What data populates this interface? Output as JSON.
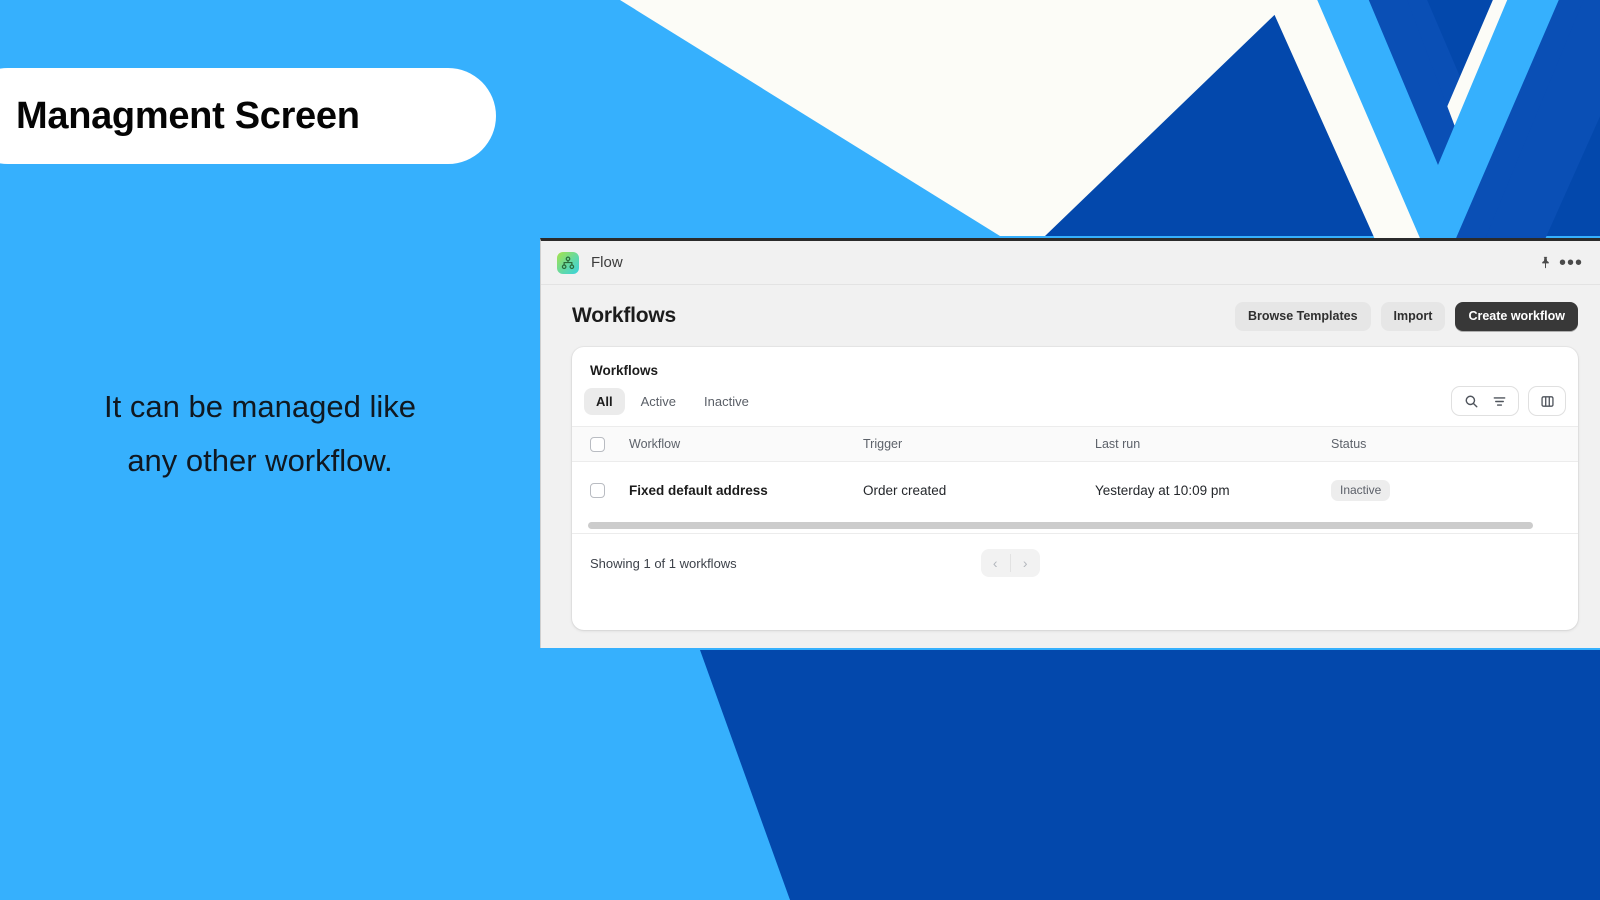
{
  "slide": {
    "title": "Managment Screen",
    "body_line1": "It can be managed like",
    "body_line2": "any other workflow.",
    "colors": {
      "light_blue": "#36b0fd",
      "dark_blue": "#0348ac",
      "off_white": "#fcfcf7"
    }
  },
  "window": {
    "appbar": {
      "app_name": "Flow",
      "app_icon": "flow-hierarchy-icon",
      "pin_icon": "pin-icon",
      "more_icon": "more-horizontal-icon"
    },
    "header": {
      "title": "Workflows",
      "buttons": [
        {
          "label": "Browse Templates",
          "style": "secondary"
        },
        {
          "label": "Import",
          "style": "secondary"
        },
        {
          "label": "Create workflow",
          "style": "primary"
        }
      ]
    },
    "card": {
      "title": "Workflows",
      "tabs": [
        {
          "label": "All",
          "active": true
        },
        {
          "label": "Active",
          "active": false
        },
        {
          "label": "Inactive",
          "active": false
        }
      ],
      "toolbar_icons": [
        "search-icon",
        "filter-icon",
        "columns-icon"
      ],
      "table": {
        "columns": [
          "Workflow",
          "Trigger",
          "Last run",
          "Status"
        ],
        "rows": [
          {
            "workflow": "Fixed default address",
            "trigger": "Order created",
            "last_run": "Yesterday at 10:09 pm",
            "status": "Inactive"
          }
        ]
      },
      "footer": {
        "summary": "Showing 1 of 1 workflows",
        "prev_label": "‹",
        "next_label": "›"
      }
    }
  }
}
